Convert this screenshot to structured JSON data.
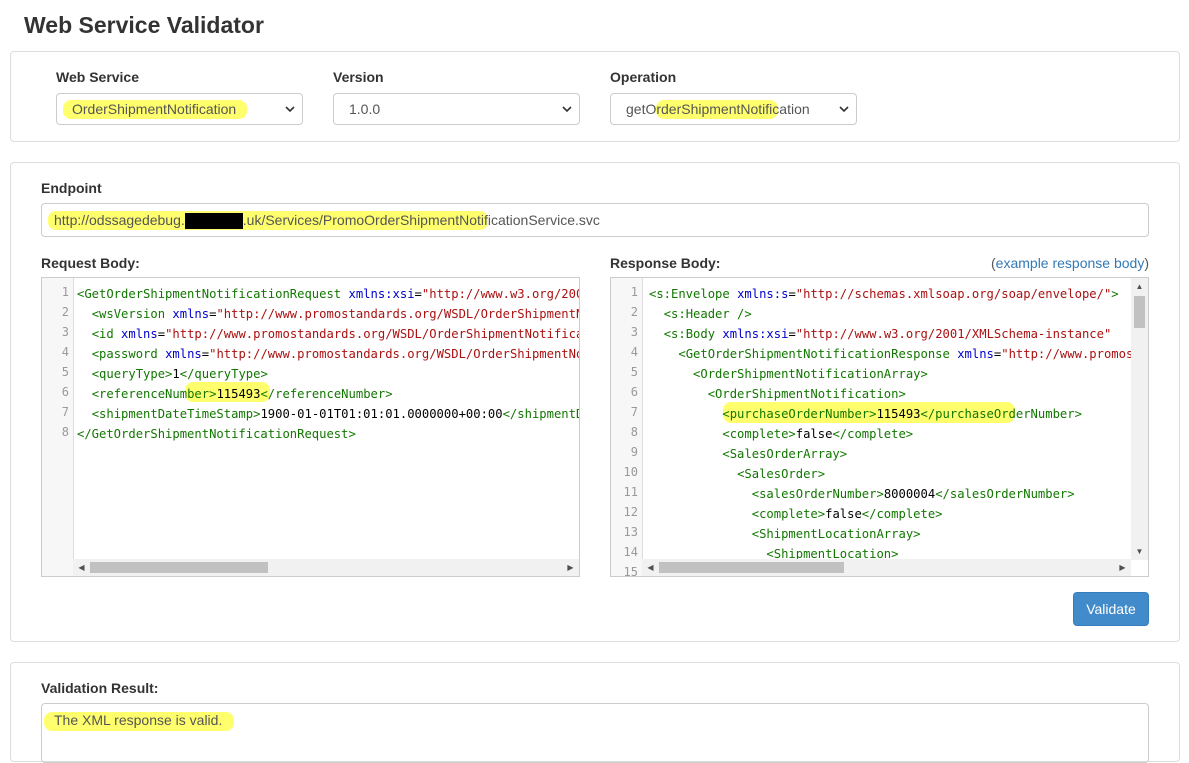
{
  "page": {
    "title": "Web Service Validator"
  },
  "selectors": {
    "web_service": {
      "label": "Web Service",
      "value": "OrderShipmentNotification"
    },
    "version": {
      "label": "Version",
      "value": "1.0.0"
    },
    "operation": {
      "label": "Operation",
      "value": "getOrderShipmentNotification"
    }
  },
  "endpoint": {
    "label": "Endpoint",
    "url_prefix": "http://odssagedebug.",
    "url_suffix": ".uk/Services/PromoOrderShipmentNotificationService.svc"
  },
  "request": {
    "label": "Request Body:",
    "line_numbers": [
      "1",
      "2",
      "3",
      "4",
      "5",
      "6",
      "7",
      "8"
    ]
  },
  "response": {
    "label": "Response Body:",
    "example_link_open": "(",
    "example_link": "example response body",
    "example_link_close": ")",
    "line_numbers": [
      "1",
      "2",
      "3",
      "4",
      "5",
      "6",
      "7",
      "8",
      "9",
      "10",
      "11",
      "12",
      "13",
      "14",
      "15"
    ]
  },
  "actions": {
    "validate_label": "Validate"
  },
  "result": {
    "label": "Validation Result:",
    "message": "The XML response is valid."
  },
  "colors": {
    "highlight": "#ffff66",
    "button": "#428bca",
    "tag": "#117700",
    "attribute": "#0000cc",
    "string": "#aa1111"
  }
}
